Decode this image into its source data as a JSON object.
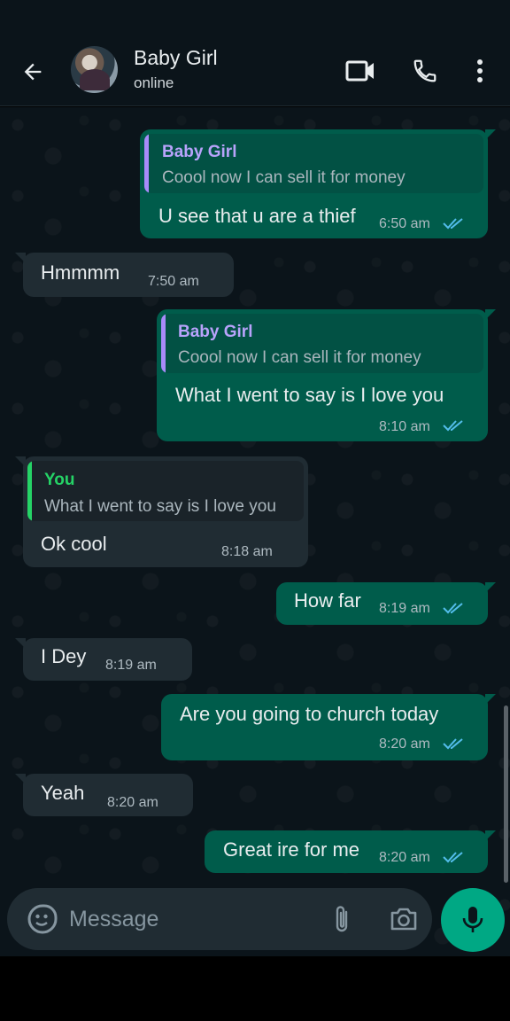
{
  "header": {
    "contact_name": "Baby Girl",
    "contact_status": "online"
  },
  "messages": [
    {
      "dir": "out",
      "quote_name": "Baby Girl",
      "quote_text": "Coool now I can sell it for money",
      "text": "U see that u are a thief",
      "time": "6:50 am",
      "read": true
    },
    {
      "dir": "in",
      "text": "Hmmmm",
      "time": "7:50 am"
    },
    {
      "dir": "out",
      "quote_name": "Baby Girl",
      "quote_text": "Coool now I can sell it for money",
      "text": "What I went to say is I love you",
      "time": "8:10 am",
      "read": true
    },
    {
      "dir": "in",
      "quote_name": "You",
      "quote_text": "What I went to say is I love you",
      "text": "Ok cool",
      "time": "8:18 am"
    },
    {
      "dir": "out",
      "text": "How far",
      "time": "8:19 am",
      "read": true
    },
    {
      "dir": "in",
      "text": "I Dey",
      "time": "8:19 am"
    },
    {
      "dir": "out",
      "text": "Are you going to church today",
      "time": "8:20 am",
      "read": true
    },
    {
      "dir": "in",
      "text": "Yeah",
      "time": "8:20 am"
    },
    {
      "dir": "out",
      "text": "Great ire for me",
      "time": "8:20 am",
      "read": true
    }
  ],
  "composer": {
    "placeholder": "Message"
  },
  "colors": {
    "accent": "#00a884",
    "outgoing_bubble": "#005c4b",
    "incoming_bubble": "#202c33",
    "read_ticks": "#53bdeb",
    "quote_baby_girl": "#a78bfa",
    "quote_you": "#25d366"
  },
  "icons": [
    "back-arrow-icon",
    "video-call-icon",
    "phone-icon",
    "more-options-icon",
    "sticker-icon",
    "attach-icon",
    "camera-icon",
    "mic-icon",
    "double-check-icon"
  ]
}
